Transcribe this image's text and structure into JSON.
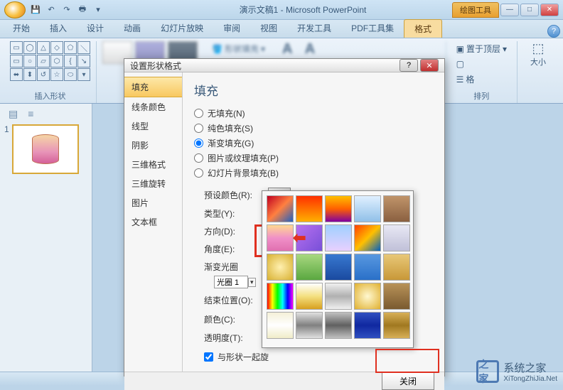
{
  "titlebar": {
    "app_title": "演示文稿1 - Microsoft PowerPoint",
    "context_tool": "绘图工具"
  },
  "win_controls": {
    "min": "—",
    "max": "□",
    "close": "✕"
  },
  "ribbon_tabs": [
    "开始",
    "插入",
    "设计",
    "动画",
    "幻灯片放映",
    "审阅",
    "视图",
    "开发工具",
    "PDF工具集",
    "格式"
  ],
  "ribbon_tabs_active": 9,
  "ribbon": {
    "insert_shapes_label": "插入形状",
    "shape_fill": "形状填充",
    "arrange_label": "排列",
    "size_label": "大小",
    "bring_front": "置于顶层",
    "send_back": ""
  },
  "slides": {
    "thumb_num": "1"
  },
  "dialog": {
    "title": "设置形状格式",
    "section_title": "填充",
    "sidebar": [
      {
        "label": "填充",
        "active": true
      },
      {
        "label": "线条颜色",
        "active": false
      },
      {
        "label": "线型",
        "active": false
      },
      {
        "label": "阴影",
        "active": false
      },
      {
        "label": "三维格式",
        "active": false
      },
      {
        "label": "三维旋转",
        "active": false
      },
      {
        "label": "图片",
        "active": false
      },
      {
        "label": "文本框",
        "active": false
      }
    ],
    "fill_options": [
      {
        "label": "无填充(N)",
        "checked": false
      },
      {
        "label": "纯色填充(S)",
        "checked": false
      },
      {
        "label": "渐变填充(G)",
        "checked": true
      },
      {
        "label": "图片或纹理填充(P)",
        "checked": false
      },
      {
        "label": "幻灯片背景填充(B)",
        "checked": false
      }
    ],
    "rows": {
      "preset": "预设颜色(R):",
      "type": "类型(Y):",
      "direction": "方向(D):",
      "angle": "角度(E):",
      "stops_label": "渐变光圈",
      "stop_selector": "光圈 1",
      "position": "结束位置(O):",
      "color": "颜色(C):",
      "transparency": "透明度(T):"
    },
    "rotate_with_shape": "与形状一起旋",
    "close_button": "关闭",
    "help": "?",
    "close_x": "✕"
  },
  "preset_gradients": [
    "linear-gradient(135deg,#c00020,#ff8040,#2060c0)",
    "linear-gradient(#ff3000,#ffb000)",
    "linear-gradient(#ffc000,#ff6000,#8000a0)",
    "linear-gradient(#e0f0ff,#90c0e8)",
    "linear-gradient(#c0946a,#8a6040)",
    "linear-gradient(#ffd890,#f090c8,#e070b0)",
    "linear-gradient(135deg,#b870f0,#7850d8)",
    "linear-gradient(#a0d0ff,#e8d0ff)",
    "linear-gradient(135deg,#ff4000,#ffc000,#0060c0)",
    "linear-gradient(#e8e8f4,#c0c0d8)",
    "radial-gradient(#fff0b0,#d8b030)",
    "linear-gradient(#a8d880,#5aa840)",
    "linear-gradient(#3878d0,#1a4aa0)",
    "linear-gradient(#5898e0,#2a70c8)",
    "linear-gradient(#e8c878,#c89838)",
    "linear-gradient(90deg,#ff0000,#ffff00,#00ff00,#00ffff,#0000ff,#ff00ff)",
    "linear-gradient(#ffffff,#f4e080,#d8a020)",
    "linear-gradient(#f0f0f0,#b0b0b0,#f0f0f0)",
    "radial-gradient(#fff8d0,#e0b030)",
    "linear-gradient(#b89258,#7a5a30)",
    "linear-gradient(#f4f0d8,#ffffff,#f0ecc8)",
    "linear-gradient(#e0e0e0,#808080,#e0e0e0)",
    "linear-gradient(#c0c0c0,#606060,#c0c0c0)",
    "linear-gradient(#3050c0,#1028a0,#3050c0)",
    "linear-gradient(#d8b058,#a07820,#d8b058)"
  ],
  "highlighted_preset_index": 5,
  "watermark": {
    "text": "系统之家",
    "url": "XiTongZhiJia.Net"
  }
}
